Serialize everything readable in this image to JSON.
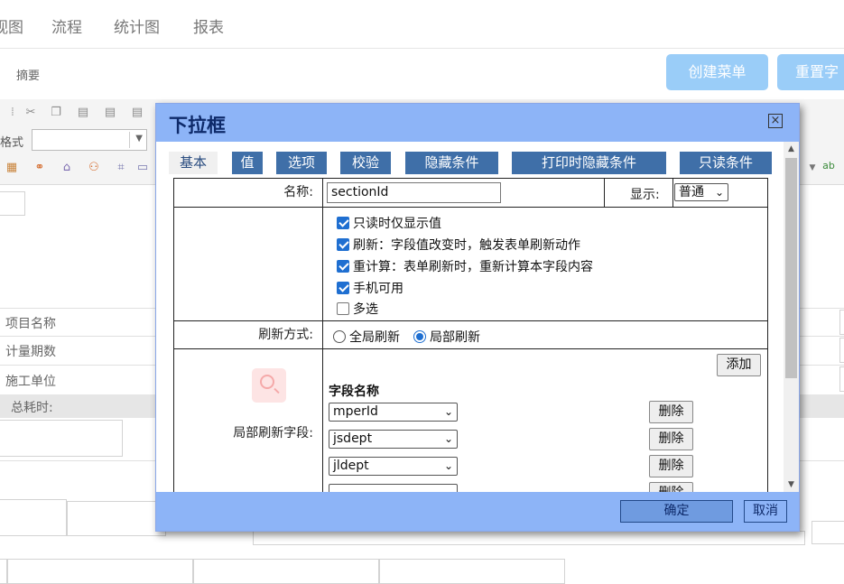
{
  "topnav": {
    "items": [
      "视图",
      "流程",
      "统计图",
      "报表"
    ]
  },
  "subbar": {
    "summary": "摘要",
    "create_menu": "创建菜单",
    "reset": "重置字"
  },
  "toolbar": {
    "format_label": "格式"
  },
  "background": {
    "labels": [
      "项目名称",
      "计量期数",
      "施工单位",
      "总耗时:"
    ]
  },
  "dialog": {
    "title": "下拉框",
    "close_glyph": "×",
    "tabs": [
      "基本",
      "值",
      "选项",
      "校验",
      "隐藏条件",
      "打印时隐藏条件",
      "只读条件"
    ],
    "active_tab": "基本",
    "name_label": "名称:",
    "name_value": "sectionId",
    "display_label": "显示:",
    "display_value": "普通",
    "checkboxes": [
      {
        "label": "只读时仅显示值",
        "checked": true
      },
      {
        "label": "刷新：字段值改变时，触发表单刷新动作",
        "checked": true
      },
      {
        "label": "重计算：表单刷新时，重新计算本字段内容",
        "checked": true
      },
      {
        "label": "手机可用",
        "checked": true
      },
      {
        "label": "多选",
        "checked": false
      }
    ],
    "refresh_mode_label": "刷新方式:",
    "refresh_options": [
      {
        "label": "全局刷新",
        "selected": false
      },
      {
        "label": "局部刷新",
        "selected": true
      }
    ],
    "partial_fields_label": "局部刷新字段:",
    "add_button": "添加",
    "field_name_header": "字段名称",
    "fields": [
      {
        "value": "mperId",
        "delete": "删除"
      },
      {
        "value": "jsdept",
        "delete": "删除"
      },
      {
        "value": "jldept",
        "delete": "删除"
      },
      {
        "value": "",
        "delete": "删除"
      }
    ],
    "ok_button": "确定",
    "cancel_button": "取消"
  }
}
